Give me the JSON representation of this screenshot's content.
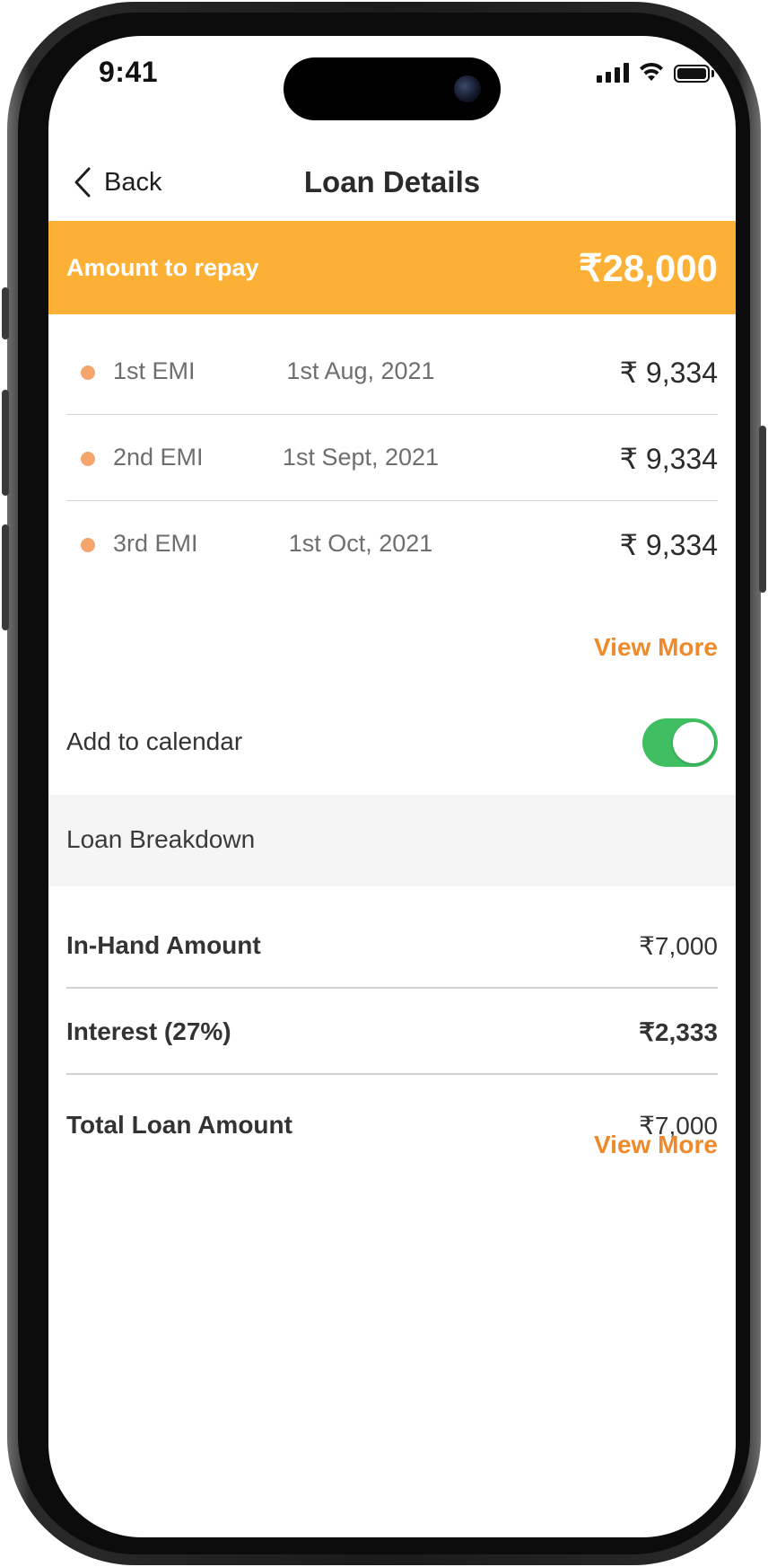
{
  "status_bar": {
    "time": "9:41"
  },
  "nav": {
    "back_label": "Back",
    "title": "Loan Details"
  },
  "repay": {
    "label": "Amount to repay",
    "amount": "₹28,000",
    "color": "#fcb035"
  },
  "emis": [
    {
      "name": "1st EMI",
      "date": "1st Aug, 2021",
      "amount": "₹ 9,334"
    },
    {
      "name": "2nd EMI",
      "date": "1st Sept, 2021",
      "amount": "₹ 9,334"
    },
    {
      "name": "3rd EMI",
      "date": "1st Oct, 2021",
      "amount": "₹ 9,334"
    }
  ],
  "emi_view_more": "View More",
  "calendar": {
    "label": "Add to calendar",
    "enabled": true,
    "toggle_color": "#3fbf62"
  },
  "breakdown": {
    "title": "Loan Breakdown",
    "rows": [
      {
        "label": "In-Hand Amount",
        "value": "₹7,000"
      },
      {
        "label": "Interest (27%)",
        "value": "₹2,333"
      },
      {
        "label": "Total Loan Amount",
        "value": "₹7,000"
      }
    ],
    "view_more": "View More"
  },
  "accent_color": "#ee8a2b"
}
